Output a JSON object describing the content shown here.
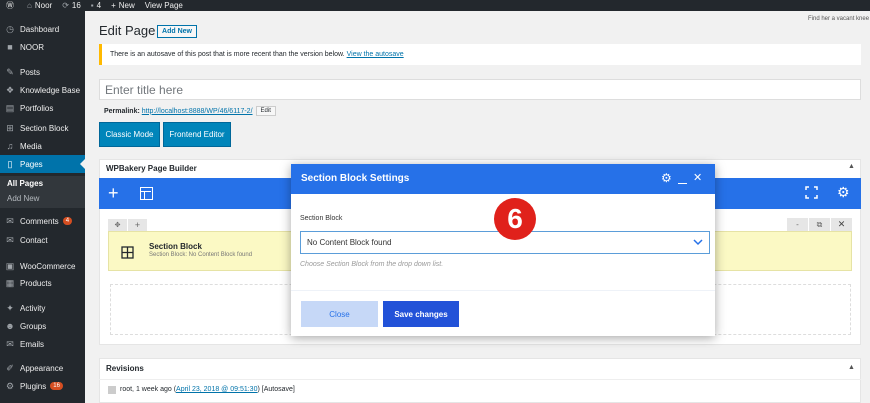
{
  "adminbar": {
    "site": "Noor",
    "updates": "16",
    "comments": "4",
    "new": "New",
    "view": "View Page",
    "helper": "Find her a vacant knee"
  },
  "sidebar": {
    "items": [
      {
        "label": "Dashboard",
        "icon": "dashboard-icon",
        "glyph": "◷"
      },
      {
        "label": "NOOR",
        "icon": "noor-logo-icon",
        "glyph": "■"
      },
      {
        "label": "Posts",
        "icon": "pushpin-icon",
        "glyph": "✎"
      },
      {
        "label": "Knowledge Base",
        "icon": "knowledge-base-icon",
        "glyph": "❖"
      },
      {
        "label": "Portfolios",
        "icon": "portfolio-icon",
        "glyph": "▤"
      },
      {
        "label": "Section Block",
        "icon": "grid-icon",
        "glyph": "⊞"
      },
      {
        "label": "Media",
        "icon": "media-icon",
        "glyph": "♫"
      },
      {
        "label": "Pages",
        "icon": "pages-icon",
        "glyph": "▯"
      }
    ],
    "sub": [
      "All Pages",
      "Add New"
    ],
    "items2": [
      {
        "label": "Comments",
        "icon": "comments-icon",
        "glyph": "✉",
        "badge": "4"
      },
      {
        "label": "Contact",
        "icon": "contact-icon",
        "glyph": "✉"
      },
      {
        "label": "WooCommerce",
        "icon": "woocommerce-icon",
        "glyph": "▣"
      },
      {
        "label": "Products",
        "icon": "products-icon",
        "glyph": "▦"
      },
      {
        "label": "Activity",
        "icon": "activity-icon",
        "glyph": "✦"
      },
      {
        "label": "Groups",
        "icon": "groups-icon",
        "glyph": "☻"
      },
      {
        "label": "Emails",
        "icon": "emails-icon",
        "glyph": "✉"
      },
      {
        "label": "Appearance",
        "icon": "appearance-icon",
        "glyph": "✐"
      },
      {
        "label": "Plugins",
        "icon": "plugins-icon",
        "glyph": "⚙",
        "badge": "16"
      }
    ]
  },
  "main": {
    "title": "Edit Page",
    "add_new": "Add New",
    "notice": "There is an autosave of this post that is more recent than the version below.",
    "notice_link": "View the autosave",
    "title_placeholder": "Enter title here",
    "permalink_label": "Permalink:",
    "permalink_url": "http://localhost:8888/WP/46/6117-2/",
    "permalink_edit": "Edit",
    "classic_mode": "Classic Mode",
    "frontend_editor": "Frontend Editor",
    "builder_title": "WPBakery Page Builder",
    "element_title": "Section Block",
    "element_sub": "Section Block: No Content Block found",
    "revisions_title": "Revisions",
    "revision_prefix": "root, 1 week ago (",
    "revision_link": "April 23, 2018 @ 09:51:30",
    "revision_suffix": ") [Autosave]"
  },
  "modal": {
    "title": "Section Block Settings",
    "field_label": "Section Block",
    "select_value": "No Content Block found",
    "help": "Choose Section Block from the drop down list.",
    "close": "Close",
    "save": "Save changes",
    "step": "6"
  },
  "colors": {
    "accent": "#2671e8",
    "wp_blue": "#0085ba",
    "sidebar": "#23282d",
    "step": "#e0211b"
  }
}
